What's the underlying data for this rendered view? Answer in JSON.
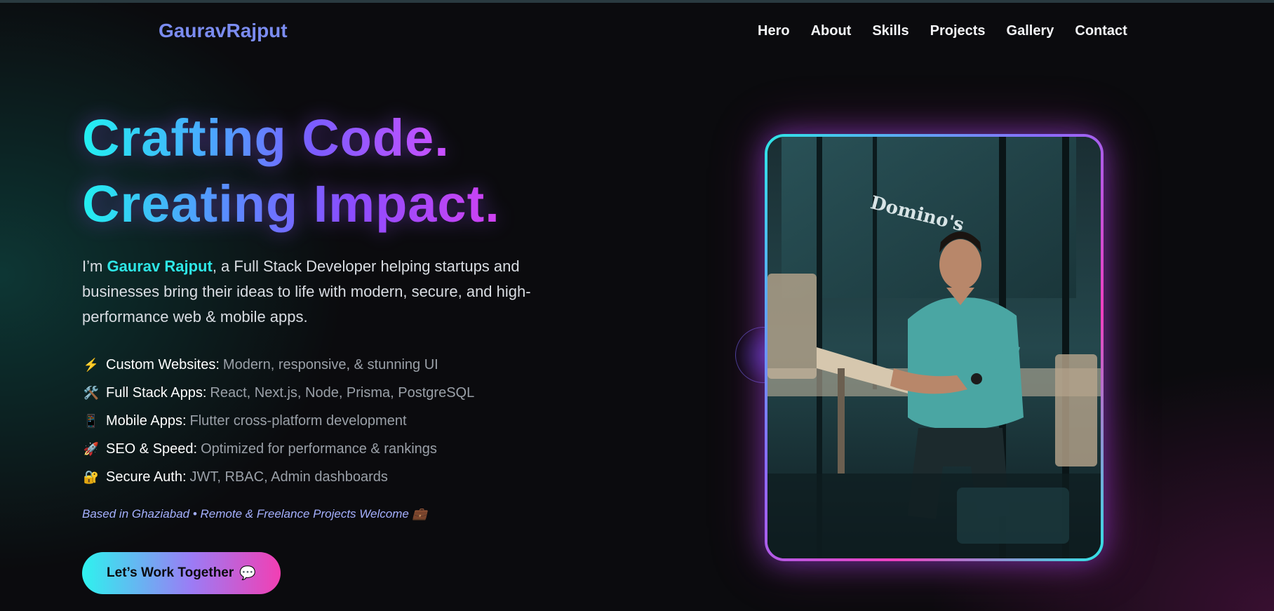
{
  "brand": {
    "logo": "GauravRajput"
  },
  "nav": {
    "items": [
      "Hero",
      "About",
      "Skills",
      "Projects",
      "Gallery",
      "Contact"
    ]
  },
  "hero": {
    "headline_line1": "Crafting Code.",
    "headline_line2": "Creating Impact.",
    "intro_prefix": "I’m ",
    "intro_name": "Gaurav Rajput",
    "intro_rest": ", a Full Stack Developer helping startups and businesses bring their ideas to life with modern, secure, and high-performance web & mobile apps.",
    "features": [
      {
        "icon": "⚡",
        "icon_name": "lightning-icon",
        "title": "Custom Websites:",
        "desc": "Modern, responsive, & stunning UI"
      },
      {
        "icon": "🛠️",
        "icon_name": "tools-icon",
        "title": "Full Stack Apps:",
        "desc": "React, Next.js, Node, Prisma, PostgreSQL"
      },
      {
        "icon": "📱",
        "icon_name": "mobile-phone-icon",
        "title": "Mobile Apps:",
        "desc": "Flutter cross-platform development"
      },
      {
        "icon": "🚀",
        "icon_name": "rocket-icon",
        "title": "SEO & Speed:",
        "desc": "Optimized for performance & rankings"
      },
      {
        "icon": "🔐",
        "icon_name": "lock-icon",
        "title": "Secure Auth:",
        "desc": "JWT, RBAC, Admin dashboards"
      }
    ],
    "location": "Based in Ghaziabad • Remote & Freelance Projects Welcome 💼",
    "cta_label": "Let’s Work Together",
    "cta_icon": "💬",
    "photo_sign_text": "Domino's"
  },
  "colors": {
    "accent_cyan": "#2ee6e6",
    "accent_purple": "#8a4dff",
    "accent_pink": "#f23fb3",
    "logo": "#7b8cf0",
    "background": "#0b0b0e"
  }
}
